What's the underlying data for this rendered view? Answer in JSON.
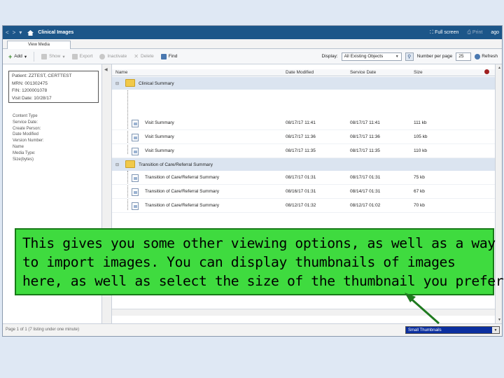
{
  "titlebar": {
    "back": "<",
    "forward": ">",
    "menu": "▾",
    "title": "Clinical Images",
    "fullscreen": "Full screen",
    "print": "Print",
    "ago": "ago"
  },
  "tabs": [
    {
      "label": "View Media"
    }
  ],
  "toolbar": {
    "add": "Add",
    "show": "Show",
    "export": "Export",
    "inactivate": "Inactivate",
    "delete": "Delete",
    "find": "Find",
    "display_label": "Display:",
    "display_value": "All Existing Objects",
    "number_per_page_label": "Number per page",
    "number_per_page_value": "25",
    "refresh": "Refresh"
  },
  "patient": {
    "patient": "Patient: ZZTEST, CERTTEST",
    "mrn": "MRN: 001302475",
    "fin": "FIN: 1200001078",
    "visit": "Visit Date: 10/28/17"
  },
  "properties": [
    "Content Type",
    "Service Date:",
    "Create Person:",
    "Date Modified",
    "Version Number:",
    "Name",
    "Media Type:",
    "Size(bytes)"
  ],
  "grid": {
    "columns": [
      "Name",
      "Date Modified",
      "Service Date",
      "Size"
    ],
    "groups": [
      {
        "name": "Clinical Summary",
        "items": [
          {
            "name": "Visit Summary",
            "modified": "08/17/17 11:41",
            "service": "08/17/17 11:41",
            "size": "111 kb"
          },
          {
            "name": "Visit Summary",
            "modified": "08/17/17 11:36",
            "service": "08/17/17 11:36",
            "size": "105 kb"
          },
          {
            "name": "Visit Summary",
            "modified": "08/17/17 11:35",
            "service": "08/17/17 11:35",
            "size": "110 kb"
          }
        ]
      },
      {
        "name": "Transition of Care/Referral Summary",
        "items": [
          {
            "name": "Transition of Care/Referral Summary",
            "modified": "08/17/17 01:31",
            "service": "08/17/17 01:31",
            "size": "75 kb"
          },
          {
            "name": "Transition of Care/Referral Summary",
            "modified": "08/16/17 01:31",
            "service": "08/14/17 01:31",
            "size": "67 kb"
          },
          {
            "name": "Transition of Care/Referral Summary",
            "modified": "08/12/17 01:32",
            "service": "08/12/17 01:02",
            "size": "70 kb"
          }
        ]
      }
    ]
  },
  "statusbar": {
    "status": "Page 1 of 1 (7 listing under one minute)",
    "thumbnail_value": "Small Thumbnails"
  },
  "callout": {
    "line1": "This gives you some other viewing options, as well as a way",
    "line2": "to import images.  You can display thumbnails of images",
    "line3": "here, as well as select the size of the thumbnail you prefer."
  },
  "colors": {
    "titlebar": "#1c5689",
    "callout_fill": "#3fdb3f",
    "callout_border": "#187a18",
    "thumbnail_select": "#0b2f9f",
    "arrow": "#1f7a1f"
  }
}
